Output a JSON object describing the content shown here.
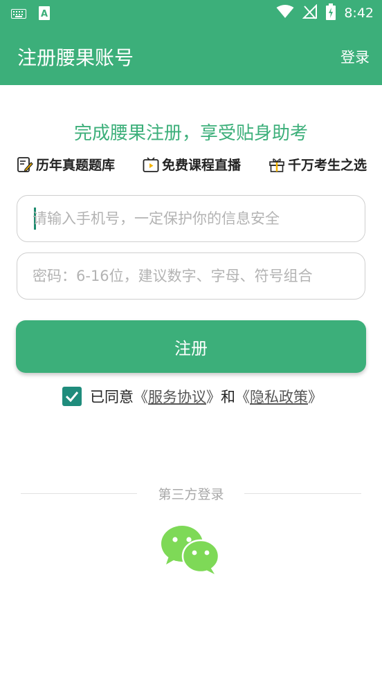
{
  "status_bar": {
    "time": "8:42",
    "icons": [
      "keyboard-icon",
      "a-app-icon",
      "wifi-icon",
      "no-signal-icon",
      "battery-charging-icon"
    ]
  },
  "app_bar": {
    "title": "注册腰果账号",
    "login_label": "登录"
  },
  "headline": "完成腰果注册，享受贴身助考",
  "features": [
    {
      "icon": "note-pencil-icon",
      "label": "历年真题题库"
    },
    {
      "icon": "tv-play-icon",
      "label": "免费课程直播"
    },
    {
      "icon": "gift-icon",
      "label": "千万考生之选"
    }
  ],
  "form": {
    "phone_placeholder": "请输入手机号，一定保护你的信息安全",
    "password_placeholder": "密码：6-16位，建议数字、字母、符号组合",
    "phone_value": "",
    "password_value": ""
  },
  "register_label": "注册",
  "agreement": {
    "checked": true,
    "prefix": "已同意",
    "open_bracket_1": "《",
    "terms_label": "服务协议",
    "close_bracket_1": "》",
    "and": "和",
    "open_bracket_2": "《",
    "privacy_label": "隐私政策",
    "close_bracket_2": "》"
  },
  "third_party": {
    "label": "第三方登录",
    "providers": [
      "wechat-icon"
    ]
  },
  "colors": {
    "primary": "#3caf7a",
    "checkbox": "#1f8c7c",
    "wechat": "#7ed957"
  }
}
